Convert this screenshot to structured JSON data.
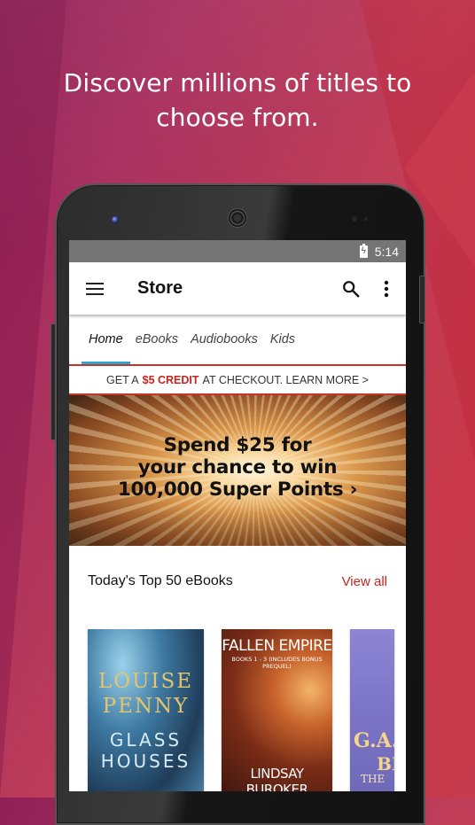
{
  "headline": {
    "line1": "Discover millions of titles to",
    "line2": "choose from."
  },
  "status_bar": {
    "battery_icon": "battery-charging-icon",
    "time": "5:14"
  },
  "app_bar": {
    "menu_icon": "hamburger-menu-icon",
    "title": "Store",
    "search_icon": "search-icon",
    "more_icon": "more-vert-icon"
  },
  "tabs": [
    {
      "label": "Home",
      "active": true
    },
    {
      "label": "eBooks",
      "active": false
    },
    {
      "label": "Audiobooks",
      "active": false
    },
    {
      "label": "Kids",
      "active": false
    }
  ],
  "promo": {
    "prefix": "GET A",
    "highlight": "$5 CREDIT",
    "suffix": "AT CHECKOUT. LEARN MORE >"
  },
  "banner": {
    "line1": "Spend $25 for",
    "line2": "your chance to win",
    "line3": "100,000 Super Points ›"
  },
  "section": {
    "title": "Today's Top 50 eBooks",
    "view_all": "View all"
  },
  "books": [
    {
      "author": "LOUISE PENNY",
      "author_line1": "LOUISE",
      "author_line2": "PENNY",
      "title_line1": "GLASS",
      "title_line2": "HOUSES"
    },
    {
      "title": "FALLEN EMPIRE",
      "subtitle": "BOOKS 1 - 3 (INCLUDES BONUS PREQUEL)",
      "author": "LINDSAY BUROKER"
    },
    {
      "author_partial": "G.A.",
      "title_partial": "BR",
      "subtitle_partial": "THE"
    }
  ]
}
